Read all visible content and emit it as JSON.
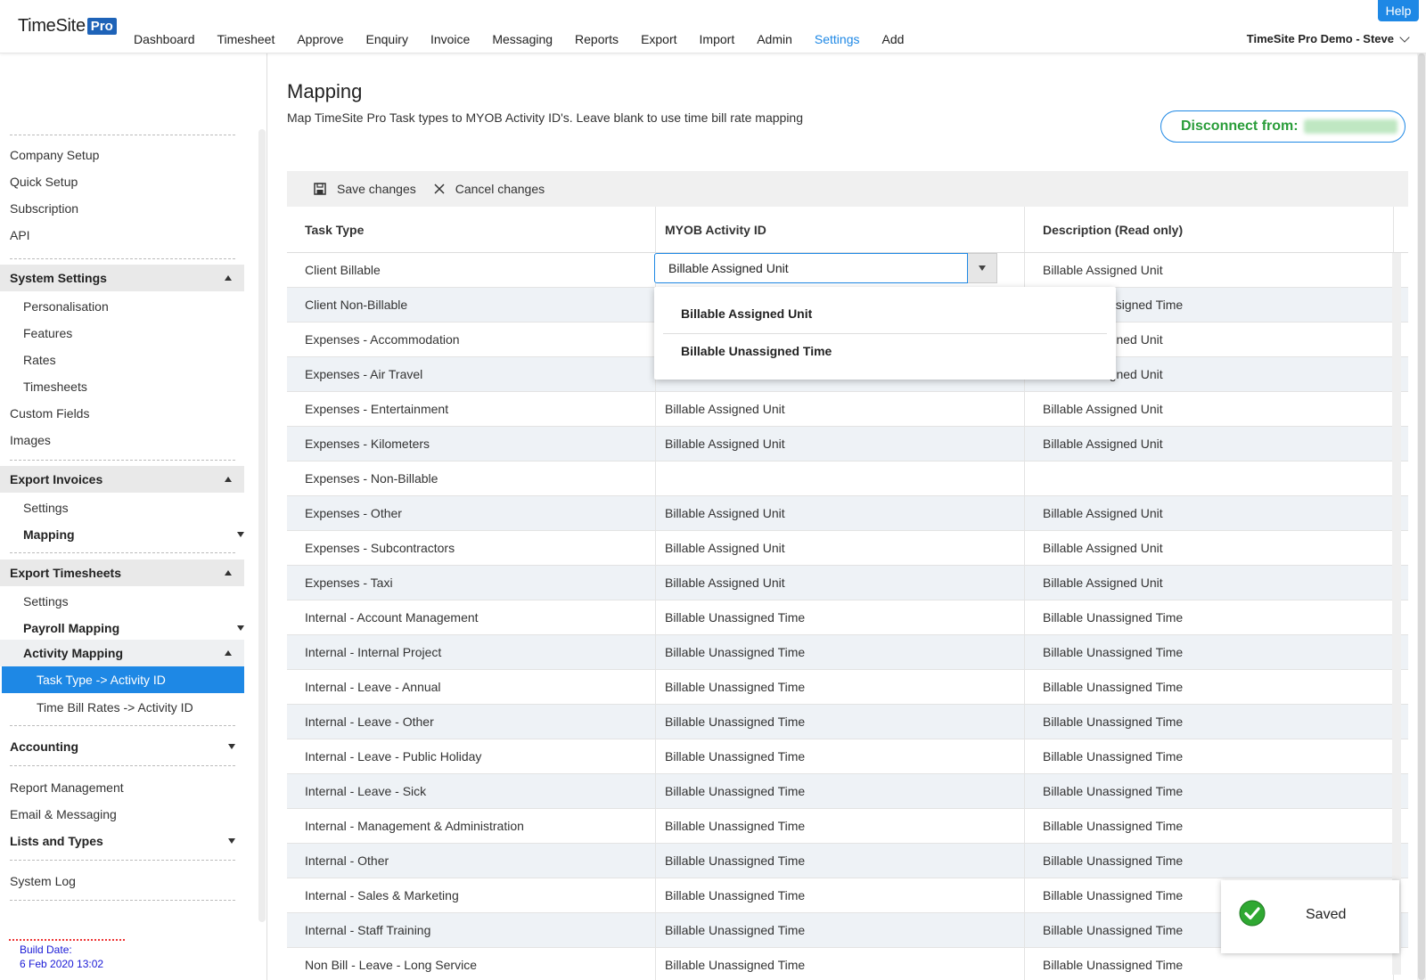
{
  "app": {
    "logo_text": "TimeSite",
    "logo_badge": "Pro",
    "help": "Help",
    "user": "TimeSite Pro Demo - Steve"
  },
  "nav": [
    "Dashboard",
    "Timesheet",
    "Approve",
    "Enquiry",
    "Invoice",
    "Messaging",
    "Reports",
    "Export",
    "Import",
    "Admin",
    "Settings",
    "Add"
  ],
  "nav_active": "Settings",
  "sidebar": {
    "top_items": [
      "Company Setup",
      "Quick Setup",
      "Subscription",
      "API"
    ],
    "system_settings": {
      "label": "System Settings",
      "items": [
        "Personalisation",
        "Features",
        "Rates",
        "Timesheets"
      ]
    },
    "mid_items": [
      "Custom Fields",
      "Images"
    ],
    "export_invoices": {
      "label": "Export Invoices",
      "settings": "Settings",
      "mapping": "Mapping"
    },
    "export_timesheets": {
      "label": "Export Timesheets",
      "settings": "Settings",
      "payroll_mapping": "Payroll Mapping",
      "activity_mapping": "Activity Mapping",
      "task_type": "Task Type -> Activity ID",
      "time_bill": "Time Bill Rates -> Activity ID"
    },
    "accounting": "Accounting",
    "bottom_items": [
      "Report Management",
      "Email & Messaging"
    ],
    "lists": "Lists and Types",
    "system_log": "System Log",
    "build_label": "Build Date:",
    "build_date": "6 Feb 2020 13:02"
  },
  "main": {
    "title": "Mapping",
    "description": "Map TimeSite Pro Task types to MYOB Activity ID's. Leave blank to use time bill rate mapping",
    "disconnect": "Disconnect from:",
    "save": "Save changes",
    "cancel": "Cancel changes",
    "columns": [
      "Task Type",
      "MYOB Activity ID",
      "Description (Read only)"
    ],
    "editor_value": "Billable Assigned Unit",
    "dropdown_options": [
      "Billable Assigned Unit",
      "Billable Unassigned Time"
    ],
    "rows": [
      [
        "Client Billable",
        "",
        "Billable Assigned Unit"
      ],
      [
        "Client Non-Billable",
        "",
        "Billable Unassigned Time"
      ],
      [
        "Expenses - Accommodation",
        "",
        "Billable Assigned Unit"
      ],
      [
        "Expenses - Air Travel",
        "",
        "Billable Assigned Unit"
      ],
      [
        "Expenses - Entertainment",
        "Billable Assigned Unit",
        "Billable Assigned Unit"
      ],
      [
        "Expenses - Kilometers",
        "Billable Assigned Unit",
        "Billable Assigned Unit"
      ],
      [
        "Expenses - Non-Billable",
        "",
        ""
      ],
      [
        "Expenses - Other",
        "Billable Assigned Unit",
        "Billable Assigned Unit"
      ],
      [
        "Expenses - Subcontractors",
        "Billable Assigned Unit",
        "Billable Assigned Unit"
      ],
      [
        "Expenses - Taxi",
        "Billable Assigned Unit",
        "Billable Assigned Unit"
      ],
      [
        "Internal - Account Management",
        "Billable Unassigned Time",
        "Billable Unassigned Time"
      ],
      [
        "Internal - Internal Project",
        "Billable Unassigned Time",
        "Billable Unassigned Time"
      ],
      [
        "Internal - Leave - Annual",
        "Billable Unassigned Time",
        "Billable Unassigned Time"
      ],
      [
        "Internal - Leave - Other",
        "Billable Unassigned Time",
        "Billable Unassigned Time"
      ],
      [
        "Internal - Leave - Public Holiday",
        "Billable Unassigned Time",
        "Billable Unassigned Time"
      ],
      [
        "Internal - Leave - Sick",
        "Billable Unassigned Time",
        "Billable Unassigned Time"
      ],
      [
        "Internal - Management & Administration",
        "Billable Unassigned Time",
        "Billable Unassigned Time"
      ],
      [
        "Internal - Other",
        "Billable Unassigned Time",
        "Billable Unassigned Time"
      ],
      [
        "Internal - Sales & Marketing",
        "Billable Unassigned Time",
        "Billable Unassigned Time"
      ],
      [
        "Internal - Staff Training",
        "Billable Unassigned Time",
        "Billable Unassigned Time"
      ],
      [
        "Non Bill - Leave - Long Service",
        "Billable Unassigned Time",
        "Billable Unassigned Time"
      ]
    ]
  },
  "toast": {
    "text": "Saved",
    "icon": "check-circle-icon"
  },
  "colors": {
    "accent": "#1e88e5",
    "logo_badge": "#1e63b8",
    "success": "#2a9d3a"
  }
}
